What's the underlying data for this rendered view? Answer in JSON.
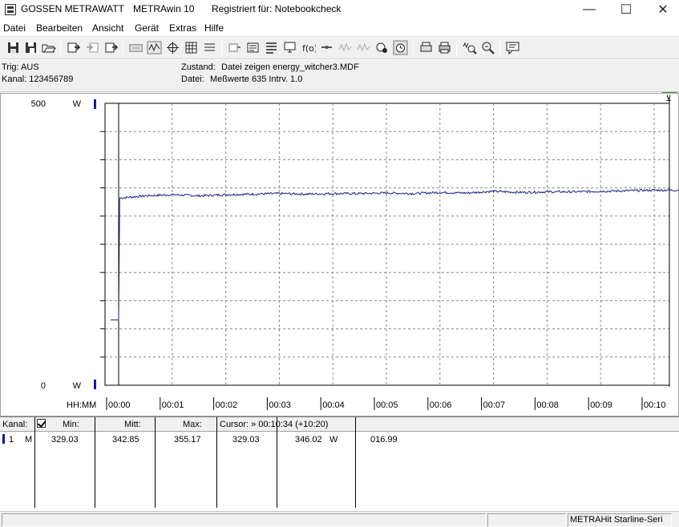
{
  "window": {
    "brand": "GOSSEN METRAWATT",
    "app": "METRAwin 10",
    "registered": "Registriert für: Notebookcheck",
    "minimize_glyph": "—",
    "maximize_glyph": "☐",
    "close_glyph": "✕"
  },
  "menu": [
    "Datei",
    "Bearbeiten",
    "Ansicht",
    "Gerät",
    "Extras",
    "Hilfe"
  ],
  "toolbar_icons": [
    "save-icon",
    "save-as-icon",
    "open-icon",
    "export-icon",
    "import-icon",
    "copy-icon",
    "keyboard-icon",
    "zoom-wave-icon",
    "crosshair-icon",
    "table-icon",
    "settings-icon",
    "channels-icon",
    "list-icon",
    "monitor-icon",
    "function-icon",
    "connect-icon",
    "wave-icon",
    "record-icon",
    "timer-icon",
    "print-preview-icon",
    "print-icon",
    "zoom-in-icon",
    "zoom-out-icon",
    "comment-icon"
  ],
  "info": {
    "trig": "Trig: AUS",
    "kanal": "Kanal:  123456789",
    "zustand_label": "Zustand:",
    "zustand_value": "Datei zeigen energy_witcher3.MDF",
    "datei_label": "Datei:",
    "datei_value": "Meßwerte 635   Intrv. 1.0"
  },
  "chart_data": {
    "type": "line",
    "y_top_label": "500",
    "y_bottom_label": "0",
    "unit_top": "W",
    "unit_bottom": "W",
    "x_axis_label": "HH:MM",
    "x_ticks": [
      "00:00",
      "00:01",
      "00:02",
      "00:03",
      "00:04",
      "00:05",
      "00:06",
      "00:07",
      "00:08",
      "00:09",
      "00:10"
    ],
    "ylim": [
      0,
      500
    ],
    "xlim_minutes": [
      0,
      10.5
    ],
    "grid": true,
    "series": [
      {
        "color": "#1a237e",
        "x_minutes": [
          -0.15,
          0.0,
          0.02,
          0.5,
          1.0,
          1.5,
          2.0,
          2.5,
          3.0,
          3.5,
          4.0,
          4.5,
          5.0,
          5.5,
          6.0,
          6.5,
          7.0,
          7.5,
          8.0,
          8.5,
          9.0,
          9.5,
          10.0,
          10.5
        ],
        "values": [
          116,
          116,
          332,
          336,
          338,
          336,
          338,
          339,
          340,
          339,
          340,
          340,
          341,
          340,
          342,
          341,
          344,
          342,
          343,
          343,
          344,
          345,
          346,
          346
        ]
      }
    ]
  },
  "table": {
    "headers": {
      "kanal": "Kanal:",
      "min": "Min:",
      "mitt": "Mitt:",
      "max": "Max:",
      "cursor": "Cursor: » 00:10:34 (+10:20)"
    },
    "rows": [
      {
        "channel": "1",
        "type": "M",
        "min": "329.03",
        "mitt": "342.85",
        "max": "355.17",
        "cursor_value": "329.03",
        "cursor_value2": "346.02",
        "unit": "W",
        "extra": "016.99"
      }
    ]
  },
  "statusbar": {
    "device": "METRAHit Starline-Seri"
  }
}
